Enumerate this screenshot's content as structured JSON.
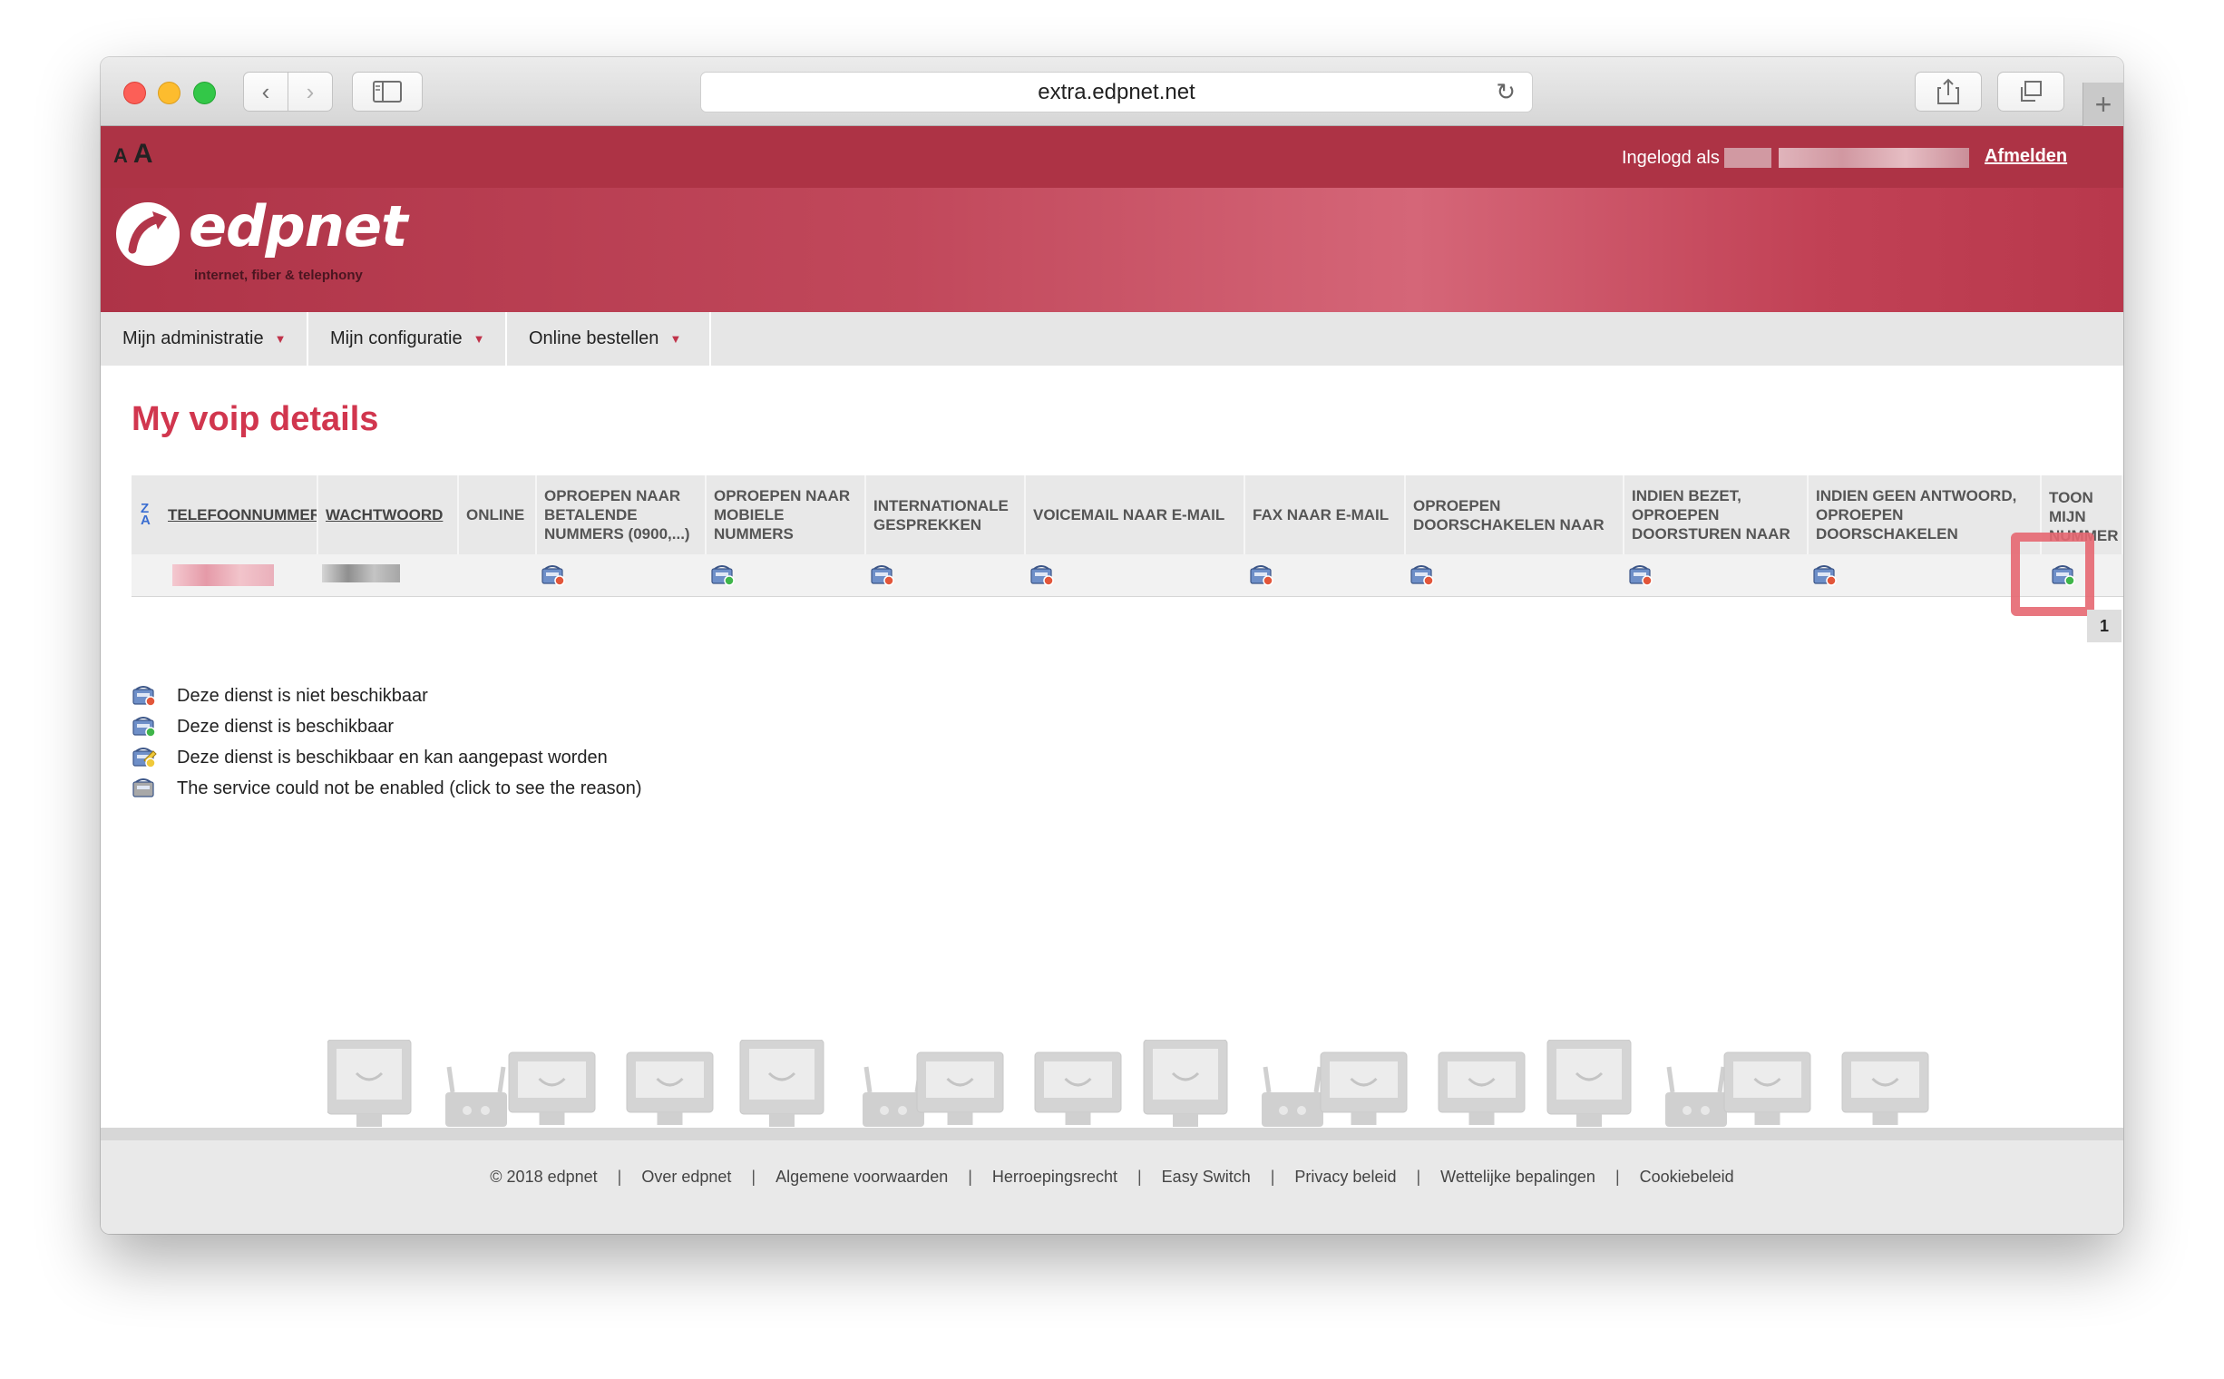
{
  "browser": {
    "url": "extra.edpnet.net",
    "back_icon": "‹",
    "forward_icon": "›",
    "new_tab_icon": "+",
    "reload_icon": "↻"
  },
  "header": {
    "font_small": "A",
    "font_large": "A",
    "logged_in_label": "Ingelogd als",
    "logout": "Afmelden",
    "logo_text": "edpnet",
    "logo_tagline": "internet, fiber & telephony"
  },
  "nav": {
    "items": [
      {
        "label": "Mijn administratie"
      },
      {
        "label": "Mijn configuratie"
      },
      {
        "label": "Online bestellen"
      }
    ]
  },
  "page": {
    "title": "My voip details"
  },
  "table": {
    "columns": [
      "TELEFOONNUMMER",
      "WACHTWOORD",
      "ONLINE",
      "OPROEPEN NAAR BETALENDE NUMMERS (0900,...)",
      "OPROEPEN NAAR MOBIELE NUMMERS",
      "INTERNATIONALE GESPREKKEN",
      "VOICEMAIL NAAR E-MAIL",
      "FAX NAAR E-MAIL",
      "OPROEPEN DOORSCHAKELEN NAAR",
      "INDIEN BEZET, OPROEPEN DOORSTUREN NAAR",
      "INDIEN GEEN ANTWOORD, OPROEPEN DOORSCHAKELEN",
      "TOON MIJN NUMMER"
    ],
    "row_status": [
      "not-available",
      "available",
      "not-available",
      "not-available",
      "not-available",
      "not-available",
      "not-available",
      "not-available",
      "available"
    ],
    "page_number": "1"
  },
  "legend": [
    {
      "status": "not-available",
      "text": "Deze dienst is niet beschikbaar"
    },
    {
      "status": "available",
      "text": "Deze dienst is beschikbaar"
    },
    {
      "status": "editable",
      "text": "Deze dienst is beschikbaar en kan aangepast worden"
    },
    {
      "status": "error",
      "text": "The service could not be enabled (click to see the reason)"
    }
  ],
  "footer": {
    "links": [
      "© 2018 edpnet",
      "Over edpnet",
      "Algemene voorwaarden",
      "Herroepingsrecht",
      "Easy Switch",
      "Privacy beleid",
      "Wettelijke bepalingen",
      "Cookiebeleid"
    ]
  },
  "colors": {
    "brand": "#ad3345",
    "title": "#d1364e",
    "highlight": "#e56771"
  }
}
